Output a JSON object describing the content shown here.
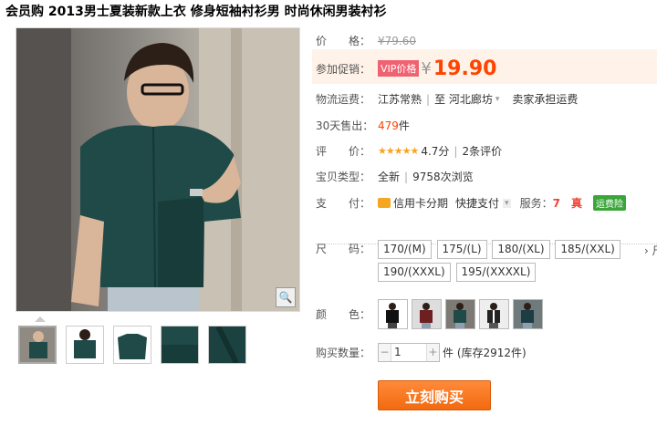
{
  "title": "会员购 2013男士夏装新款上衣 修身短袖衬衫男 时尚休闲男装衬衫",
  "price": {
    "label": "价　　格：",
    "original": "¥79.60"
  },
  "promo": {
    "label": "参加促销：",
    "badge": "VIP价格",
    "currency": "¥",
    "value": "19.90"
  },
  "shipping": {
    "label": "物流运费：",
    "from": "江苏常熟",
    "to": "至  河北廊坊",
    "note": "卖家承担运费"
  },
  "sold": {
    "label": "30天售出：",
    "count": "479",
    "unit": "件"
  },
  "rating": {
    "label": "评　　价：",
    "stars": "★★★★★",
    "score": "4.7分",
    "reviews": "2条评价"
  },
  "item_type": {
    "label": "宝贝类型：",
    "condition": "全新",
    "views": "9758次浏览"
  },
  "payment": {
    "label": "支　　付：",
    "installment": "信用卡分期",
    "quick": "快捷支付",
    "service_label": "服务：",
    "service_badge": "运费险"
  },
  "size": {
    "label": "尺　　码：",
    "options": [
      "170/(M)",
      "175/(L)",
      "180/(XL)",
      "185/(XXL)",
      "190/(XXXL)",
      "195/(XXXXL)"
    ],
    "more": "› 尺"
  },
  "color": {
    "label": "颜　　色："
  },
  "quantity": {
    "label": "购买数量：",
    "value": "1",
    "stock": "件 (库存2912件)"
  },
  "buy_button": "立刻购买",
  "colors": {
    "accent": "#ff4400",
    "buy": "#f26a10",
    "shirt": "#1f4a48"
  }
}
